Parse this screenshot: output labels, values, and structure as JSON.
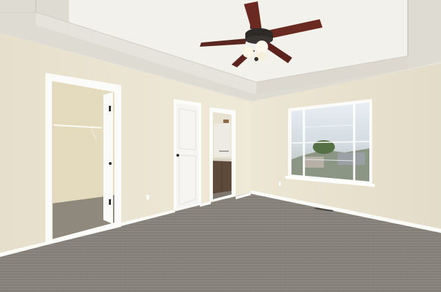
{
  "scene": {
    "description_type": "photo",
    "colors": {
      "ceiling": "#eeece6",
      "ceiling_shadow": "#dcd9d1",
      "wall_left": "#ece6d3",
      "wall_right": "#e8e2cf",
      "wall_back": "#ebe5d2",
      "trim": "#ffffff",
      "carpet": "#8c8780",
      "carpet_dark": "#7a756e",
      "closet": "#e6dcc0",
      "fan_blade": "#6a2a22",
      "fan_body": "#2e2a28",
      "window_glass": "#cdd6dd"
    }
  }
}
